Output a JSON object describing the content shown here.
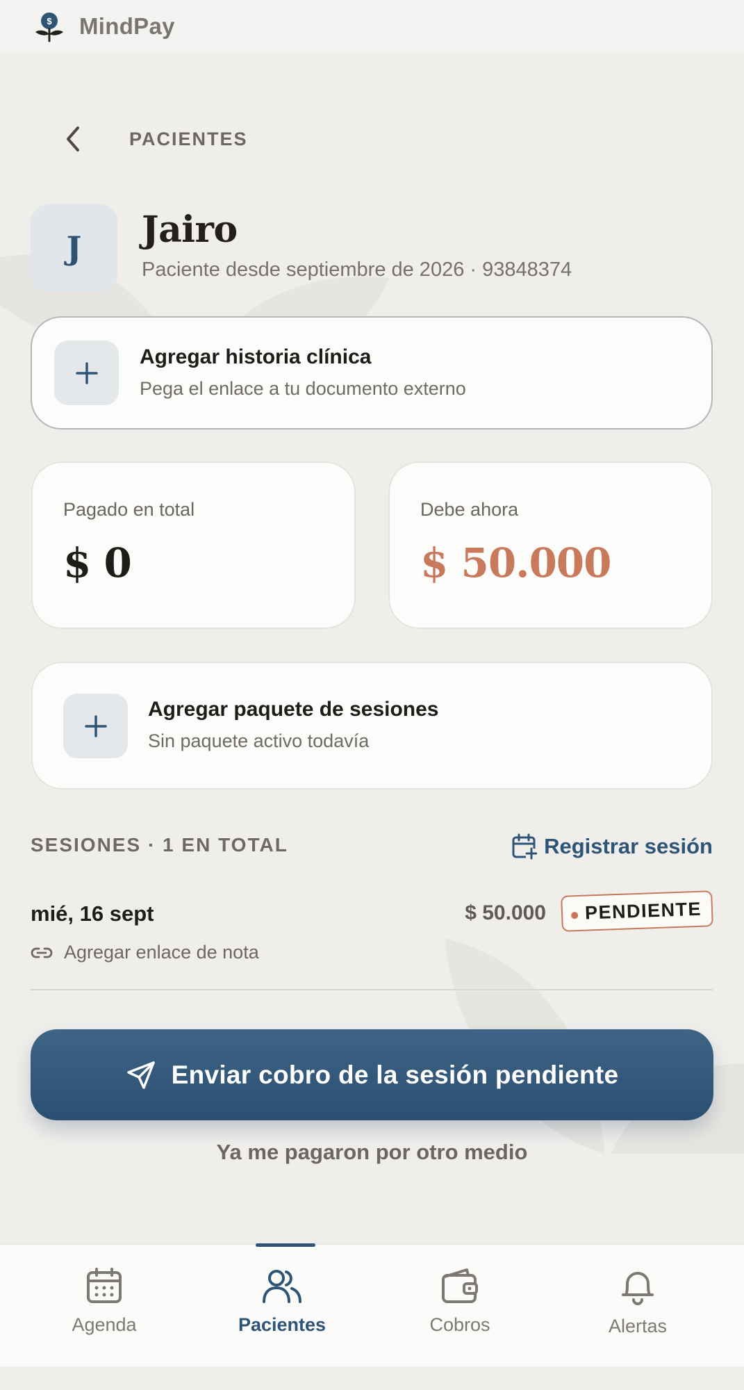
{
  "app": {
    "title": "MindPay"
  },
  "nav": {
    "back_label": "PACIENTES"
  },
  "patient": {
    "initial": "J",
    "name": "Jairo",
    "subtitle": "Paciente desde septiembre de 2026 · 93848374"
  },
  "history_card": {
    "title": "Agregar historia clínica",
    "subtitle": "Pega el enlace a tu documento externo"
  },
  "stats": {
    "paid_label": "Pagado en total",
    "paid_value": "$ 0",
    "owe_label": "Debe ahora",
    "owe_value": "$ 50.000"
  },
  "package_card": {
    "title": "Agregar paquete de sesiones",
    "subtitle": "Sin paquete activo todavía"
  },
  "sessions": {
    "heading": "SESIONES · 1 EN TOTAL",
    "register_label": "Registrar sesión",
    "items": [
      {
        "date": "mié, 16 sept",
        "amount": "$ 50.000",
        "status": "PENDIENTE",
        "note_label": "Agregar enlace de nota"
      }
    ]
  },
  "actions": {
    "primary_label": "Enviar cobro de la sesión pendiente",
    "secondary_label": "Ya me pagaron por otro medio"
  },
  "tabs": [
    {
      "label": "Agenda",
      "icon": "calendar-icon",
      "active": false
    },
    {
      "label": "Pacientes",
      "icon": "users-icon",
      "active": true
    },
    {
      "label": "Cobros",
      "icon": "wallet-icon",
      "active": false
    },
    {
      "label": "Alertas",
      "icon": "bell-icon",
      "active": false
    }
  ],
  "colors": {
    "accent": "#2e5476",
    "owed": "#c97a5c",
    "paid": "#1f1d1a",
    "background": "#efeeeb"
  }
}
